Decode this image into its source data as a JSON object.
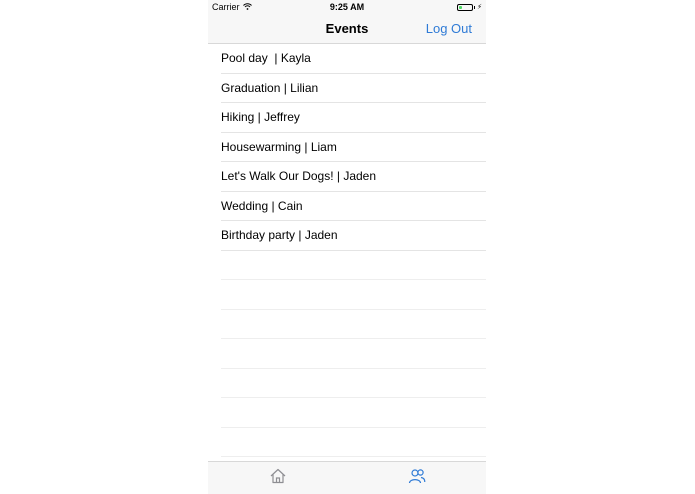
{
  "status_bar": {
    "carrier": "Carrier",
    "time": "9:25 AM",
    "battery_level": 0.25,
    "battery_color": "#4cd964"
  },
  "nav": {
    "title": "Events",
    "logout_label": "Log Out",
    "accent_color": "#2f7bd6"
  },
  "events": [
    "Pool day  | Kayla",
    "Graduation | Lilian",
    "Hiking | Jeffrey",
    "Housewarming | Liam",
    "Let's Walk Our Dogs! | Jaden",
    "Wedding | Cain",
    "Birthday party | Jaden"
  ],
  "tabs": [
    {
      "icon": "home-icon",
      "selected": false
    },
    {
      "icon": "people-icon",
      "selected": true
    }
  ]
}
